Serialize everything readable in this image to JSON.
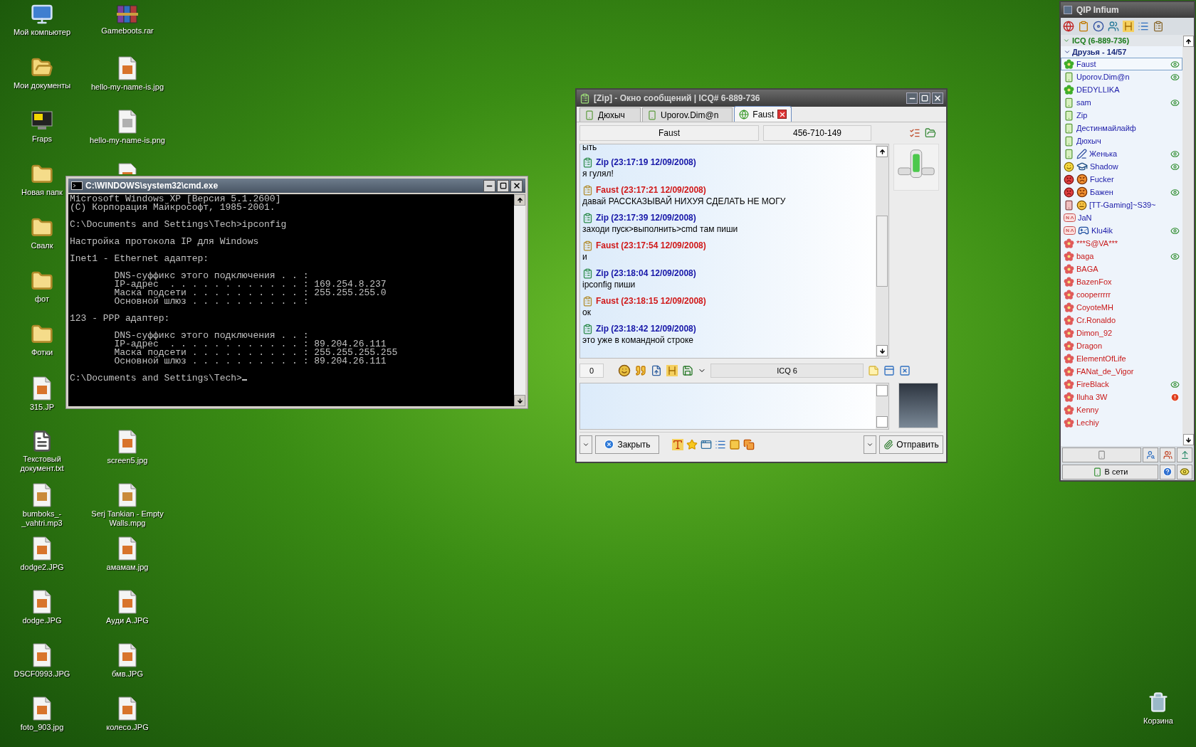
{
  "desktop": {
    "left_column": [
      {
        "label": "Мой компьютер",
        "kind": "computer"
      },
      {
        "label": "Мои документы",
        "kind": "documents"
      },
      {
        "label": "Fraps",
        "kind": "app"
      },
      {
        "label": "Новая папк",
        "kind": "folder"
      },
      {
        "label": "Свалк",
        "kind": "folder"
      },
      {
        "label": "фот",
        "kind": "folder"
      },
      {
        "label": "Фотки",
        "kind": "folder"
      },
      {
        "label": "315.JP",
        "kind": "image"
      },
      {
        "label": "Текстовый документ.txt",
        "kind": "text"
      },
      {
        "label": "bumboks_-_vahtri.mp3",
        "kind": "media"
      },
      {
        "label": "dodge2.JPG",
        "kind": "image"
      },
      {
        "label": "dodge.JPG",
        "kind": "image"
      },
      {
        "label": "DSCF0993.JPG",
        "kind": "image"
      },
      {
        "label": "foto_903.jpg",
        "kind": "image"
      }
    ],
    "right_column_top": [
      {
        "label": "Gameboots.rar",
        "kind": "archive"
      },
      {
        "label": "hello-my-name-is.jpg",
        "kind": "image"
      },
      {
        "label": "hello-my-name-is.png",
        "kind": "png"
      },
      {
        "kind": "image"
      }
    ],
    "right_column_bottom": [
      {
        "label": "screen5.jpg",
        "kind": "image"
      },
      {
        "label": "Serj Tankian - Empty Walls.mpg",
        "kind": "media"
      },
      {
        "label": "амамам.jpg",
        "kind": "image"
      },
      {
        "label": "Ауди А.JPG",
        "kind": "image"
      },
      {
        "label": "бмв.JPG",
        "kind": "image"
      },
      {
        "label": "колесо.JPG",
        "kind": "image"
      }
    ],
    "recycle_bin": {
      "label": "Корзина"
    }
  },
  "cmd_window": {
    "title": "C:\\WINDOWS\\system32\\cmd.exe",
    "blocks": [
      [
        "Microsoft Windows XP [Версия 5.1.2600]",
        "(C) Корпорация Майкрософт, 1985-2001."
      ],
      [
        "C:\\Documents and Settings\\Tech>ipconfig"
      ],
      [
        "Настройка протокола IP для Windows"
      ],
      [
        "Inet1 - Ethernet адаптер:"
      ],
      [
        "        DNS-суффикс этого подключения . . :",
        "        IP-адрес  . . . . . . . . . . . . : 169.254.8.237",
        "        Маска подсети . . . . . . . . . . : 255.255.255.0",
        "        Основной шлюз . . . . . . . . . . :"
      ],
      [
        "123 - PPP адаптер:"
      ],
      [
        "        DNS-суффикс этого подключения . . :",
        "        IP-адрес  . . . . . . . . . . . . : 89.204.26.111",
        "        Маска подсети . . . . . . . . . . : 255.255.255.255",
        "        Основной шлюз . . . . . . . . . . : 89.204.26.111"
      ]
    ],
    "prompt": "C:\\Documents and Settings\\Tech>"
  },
  "chat_window": {
    "title": "[Zip] - Окно сообщений | ICQ# 6-889-736",
    "tabs": [
      {
        "label": "Дюхыч",
        "selected": false
      },
      {
        "label": "Uporov.Dim@n",
        "selected": false
      },
      {
        "label": "Faust",
        "selected": true
      }
    ],
    "contact_name": "Faust",
    "contact_uin": "456-710-149",
    "cut_line": "ыть",
    "messages": [
      {
        "kind": "outgoing",
        "header": "Zip (23:17:19 12/09/2008)",
        "text": "я гулял!"
      },
      {
        "kind": "incoming",
        "header": "Faust (23:17:21 12/09/2008)",
        "text": "давай РАССКАЗЫВАЙ НИХУЯ СДЕЛАТЬ НЕ МОГУ"
      },
      {
        "kind": "outgoing",
        "header": "Zip (23:17:39 12/09/2008)",
        "text": "заходи пуск>выполнить>cmd там пиши"
      },
      {
        "kind": "incoming",
        "header": "Faust (23:17:54 12/09/2008)",
        "text": "и"
      },
      {
        "kind": "outgoing",
        "header": "Zip (23:18:04 12/09/2008)",
        "text": "ipconfig пиши"
      },
      {
        "kind": "incoming",
        "header": "Faust (23:18:15 12/09/2008)",
        "text": "ок"
      },
      {
        "kind": "outgoing",
        "header": "Zip (23:18:42 12/09/2008)",
        "text": "это уже в командной строке"
      }
    ],
    "counter": "0",
    "protocol": "ICQ 6",
    "close_button": "Закрыть",
    "send_button": "Отправить"
  },
  "contact_list": {
    "title": "QIP Infium",
    "account": "ICQ (6-889-736)",
    "group": "Друзья - 14/57",
    "contacts": [
      {
        "name": "Faust",
        "kind": "icq",
        "selected": true,
        "visible": true
      },
      {
        "name": "Uporov.Dim@n",
        "kind": "qip",
        "selected": false,
        "visible": true
      },
      {
        "name": "DEDYLLIKA",
        "kind": "icq",
        "selected": false
      },
      {
        "name": "sam",
        "kind": "qip",
        "selected": false,
        "visible": true
      },
      {
        "name": "Zip",
        "kind": "qip",
        "selected": false
      },
      {
        "name": "Дестинмайлайф",
        "kind": "qip",
        "selected": false
      },
      {
        "name": "Дюхыч",
        "kind": "qip",
        "selected": false
      },
      {
        "name": "Женька",
        "kind": "qip",
        "extra_icon": {
          "kind": "pen"
        },
        "selected": false,
        "visible": true
      },
      {
        "name": "Shadow",
        "kind": "happy",
        "extra_icon": {
          "kind": "cap"
        },
        "selected": false,
        "visible": true
      },
      {
        "name": "Fucker",
        "kind": "angry",
        "extra_icon": {
          "kind": "angry"
        },
        "selected": false
      },
      {
        "name": "Бажен",
        "kind": "angry",
        "extra_icon": {
          "kind": "angry"
        },
        "selected": false,
        "visible": true
      },
      {
        "name": "[TT-Gaming]~S39~",
        "kind": "busy",
        "extra_icon": {
          "kind": "sleepy"
        },
        "selected": false
      },
      {
        "name": "JaN",
        "kind": "na",
        "selected": false
      },
      {
        "name": "Klu4ik",
        "kind": "na",
        "extra_icon": {
          "kind": "joystick"
        },
        "selected": false,
        "visible": true
      },
      {
        "name": "***S@VA***",
        "kind": "offline",
        "selected": false
      },
      {
        "name": "baga",
        "kind": "offline",
        "selected": false,
        "visible": true
      },
      {
        "name": "BAGA",
        "kind": "offline",
        "selected": false
      },
      {
        "name": "BazenFox",
        "kind": "offline",
        "selected": false
      },
      {
        "name": "cooperrrrr",
        "kind": "offline",
        "selected": false
      },
      {
        "name": "CoyoteMH",
        "kind": "offline",
        "selected": false
      },
      {
        "name": "Cr.Ronaldo",
        "kind": "offline",
        "selected": false
      },
      {
        "name": "Dimon_92",
        "kind": "offline",
        "selected": false
      },
      {
        "name": "Dragon",
        "kind": "offline",
        "selected": false
      },
      {
        "name": "ElementOfLife",
        "kind": "offline",
        "selected": false
      },
      {
        "name": "FANat_de_Vigor",
        "kind": "offline",
        "selected": false
      },
      {
        "name": "FireBlack",
        "kind": "offline",
        "selected": false,
        "visible": true
      },
      {
        "name": "Iluha 3W",
        "kind": "offline",
        "selected": false,
        "alert": true
      },
      {
        "name": "Kenny",
        "kind": "offline",
        "selected": false
      },
      {
        "name": "Lechiy",
        "kind": "offline",
        "selected": false
      }
    ],
    "status_button": "В сети"
  }
}
